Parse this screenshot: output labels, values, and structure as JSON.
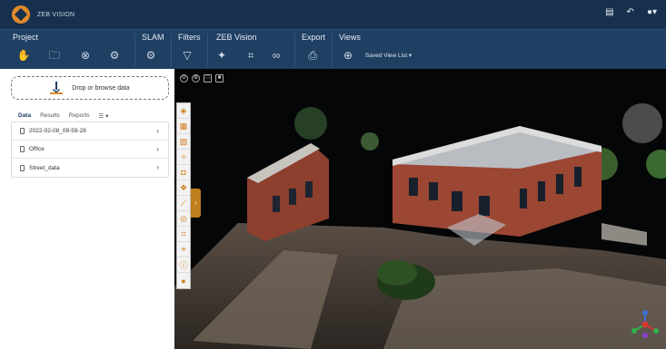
{
  "app": {
    "name": "ZEB VISION"
  },
  "title_icons": [
    "document-icon",
    "undo-icon",
    "user-menu-icon"
  ],
  "ribbon": {
    "groups": {
      "project": "Project",
      "slam": "SLAM",
      "filters": "Filters",
      "zeb_vision": "ZEB Vision",
      "export": "Export",
      "views": "Views"
    },
    "saved_view_list": "Saved View List ▾"
  },
  "left_panel": {
    "drop_label": "Drop or browse data",
    "tabs": [
      "Data",
      "Results",
      "Reports",
      "☰ ▾"
    ],
    "items": [
      "2022-02-08_09-59-28",
      "Office",
      "Street_data"
    ]
  },
  "viewer": {
    "top_tools": [
      "⊖",
      "⊕",
      "□",
      "■"
    ],
    "side_tools": [
      "cube-icon",
      "grid-icon",
      "layers-icon",
      "bulb-icon",
      "camera-icon",
      "group-icon",
      "measure-icon",
      "ring-icon",
      "crop-icon",
      "crop-alt-icon",
      "info-icon",
      "orange-dot-icon"
    ],
    "collapse_arrow": "‹"
  },
  "colors": {
    "accent": "#e08a2a",
    "ribbon": "#1f3f63",
    "title": "#17304d"
  }
}
